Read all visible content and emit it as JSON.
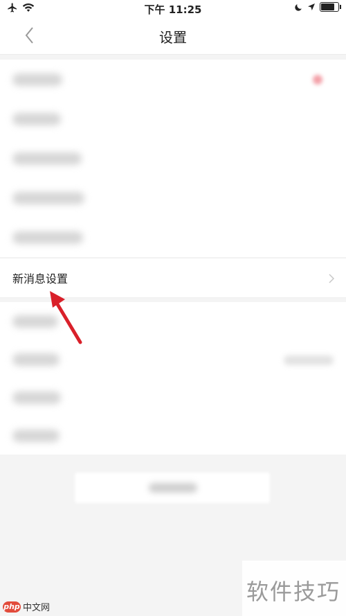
{
  "status_bar": {
    "time": "下午 11:25",
    "battery_level": 0.85
  },
  "nav": {
    "title": "设置"
  },
  "settings": {
    "highlighted_item": "新消息设置"
  },
  "watermark": {
    "text": "软件技巧",
    "logo_badge": "php",
    "logo_text": "中文网"
  },
  "colors": {
    "arrow": "#d9202a",
    "accent": "#e24b3b"
  }
}
